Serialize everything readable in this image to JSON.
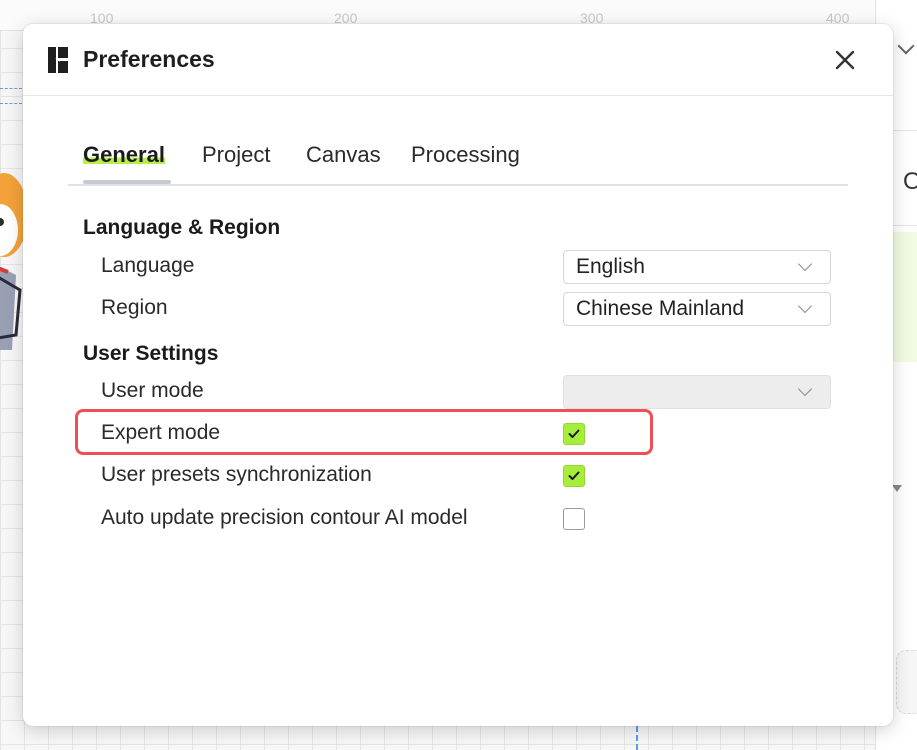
{
  "ruler": {
    "labels": [
      "100",
      "200",
      "300",
      "400"
    ]
  },
  "right_panel": {
    "letter": "O"
  },
  "dialog": {
    "title": "Preferences",
    "tabs": [
      {
        "label": "General",
        "active": true
      },
      {
        "label": "Project",
        "active": false
      },
      {
        "label": "Canvas",
        "active": false
      },
      {
        "label": "Processing",
        "active": false
      }
    ],
    "language_region": {
      "title": "Language & Region",
      "language_label": "Language",
      "language_value": "English",
      "region_label": "Region",
      "region_value": "Chinese Mainland"
    },
    "user_settings": {
      "title": "User Settings",
      "user_mode_label": "User mode",
      "user_mode_value": "",
      "expert_mode_label": "Expert mode",
      "expert_mode_checked": true,
      "presets_sync_label": "User presets synchronization",
      "presets_sync_checked": true,
      "auto_update_label": "Auto update precision contour AI model",
      "auto_update_checked": false
    }
  },
  "colors": {
    "accent_green": "#a7ee3c",
    "highlight_red": "#ee4f57"
  },
  "icons": {
    "app": "app-logo-icon",
    "close": "close-icon",
    "chevron": "chevron-down-icon",
    "check": "check-icon"
  }
}
